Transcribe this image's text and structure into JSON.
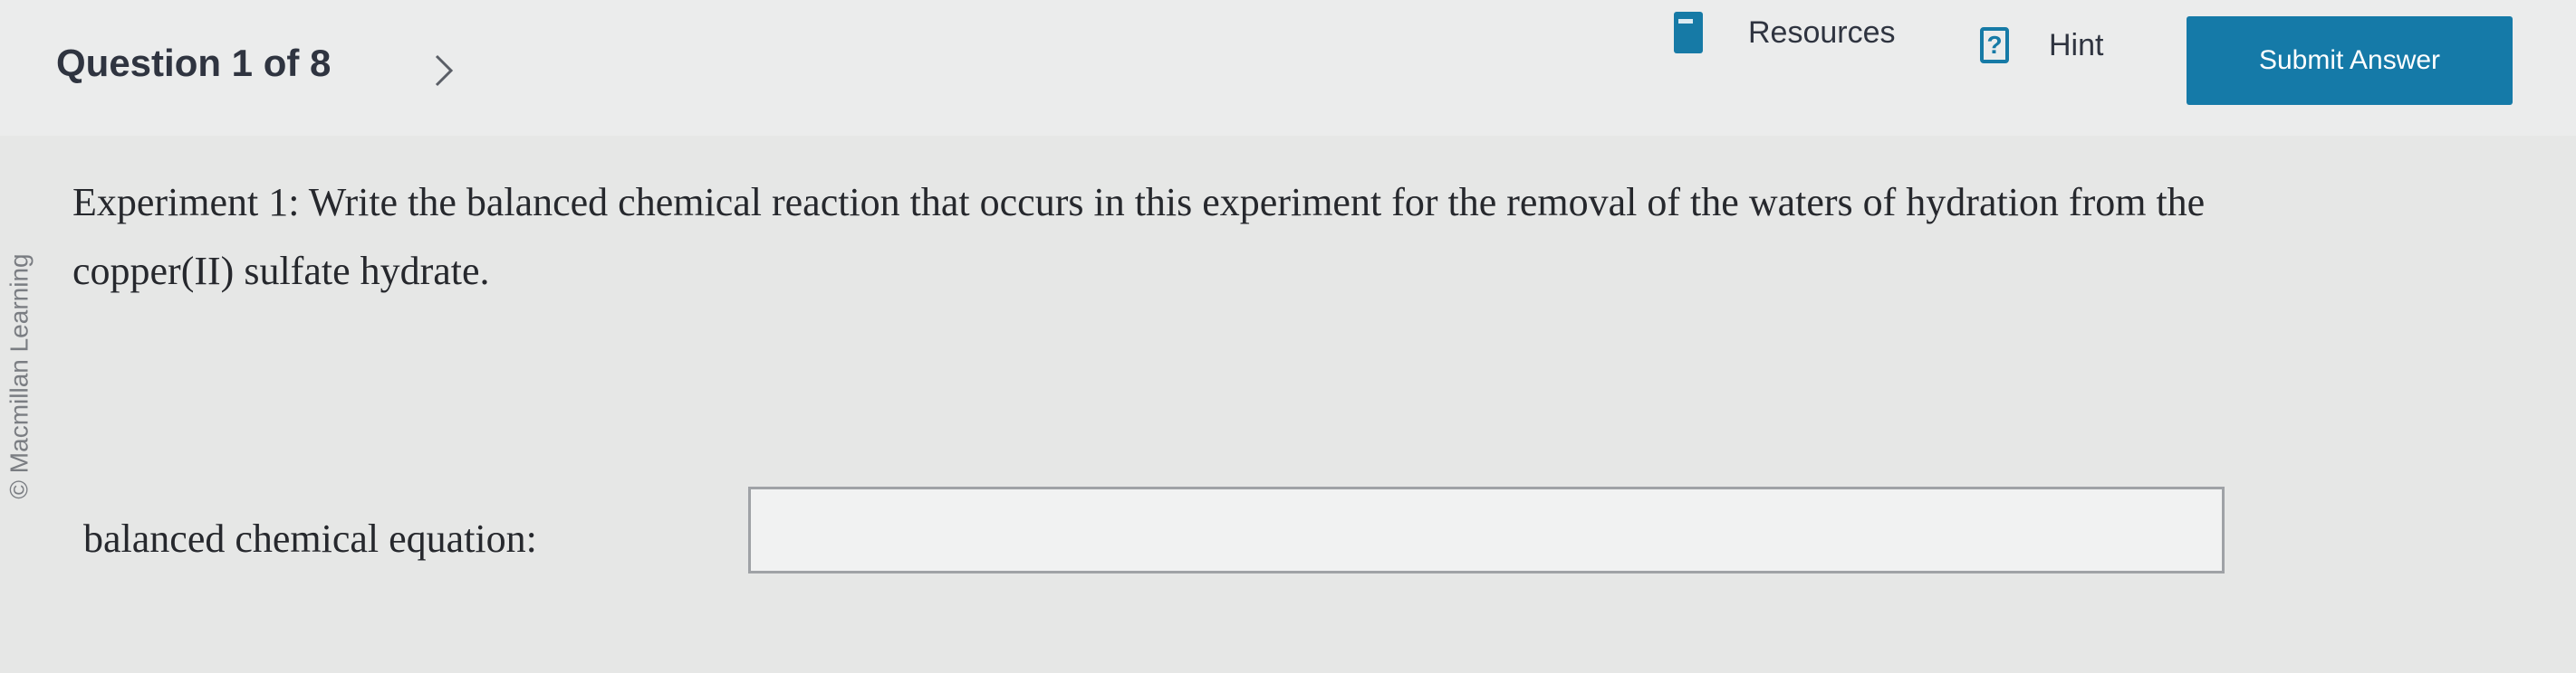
{
  "header": {
    "question_counter": "Question 1 of 8",
    "resources_label": "Resources",
    "hint_label": "Hint",
    "hint_icon_glyph": "?",
    "submit_label": "Submit Answer"
  },
  "sidebar": {
    "copyright": "© Macmillan Learning"
  },
  "question": {
    "prompt": "Experiment 1: Write the balanced chemical reaction that occurs in this experiment for the removal of the waters of hydration from the copper(II) sulfate hydrate."
  },
  "answer": {
    "label": "balanced chemical equation:",
    "value": ""
  },
  "colors": {
    "accent": "#167aa6",
    "background": "#e6e7e6",
    "text": "#2b2d33"
  },
  "icons": [
    "chevron-right-icon",
    "resources-icon",
    "hint-icon"
  ]
}
